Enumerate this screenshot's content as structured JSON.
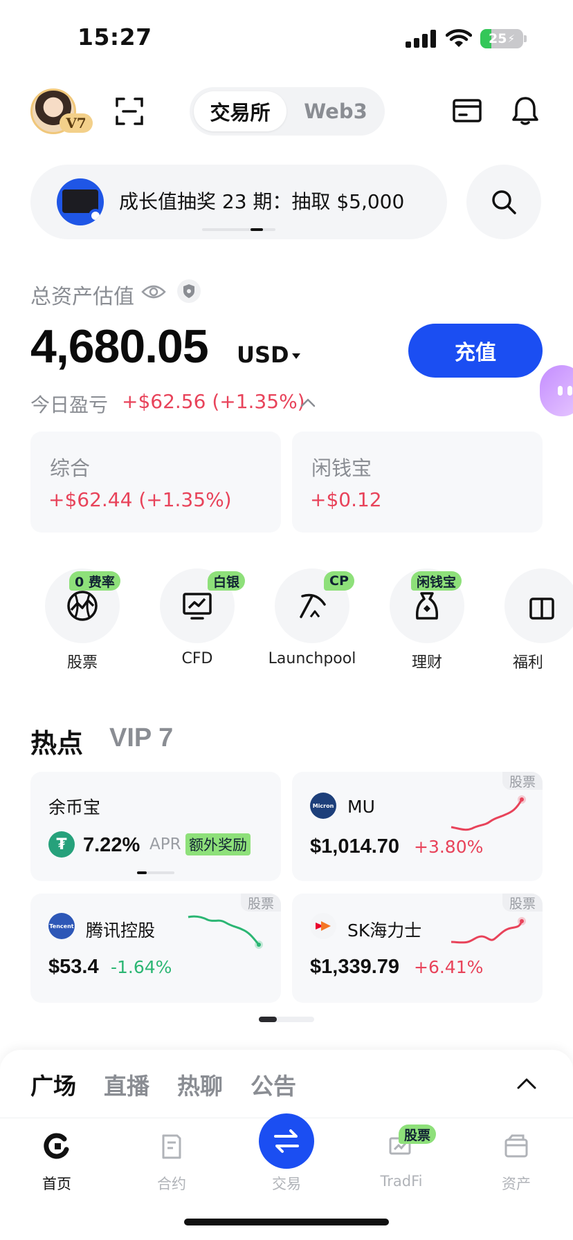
{
  "status_bar": {
    "time": "15:27",
    "battery": "25",
    "battery_level": 0.25
  },
  "header": {
    "vip_badge": "V7",
    "segments": [
      "交易所",
      "Web3"
    ],
    "active_segment": "交易所"
  },
  "promo": {
    "text": "成长值抽奖 23 期：抽取 $5,000"
  },
  "assets": {
    "label": "总资产估值",
    "amount": "4,680.05",
    "currency": "USD",
    "deposit_label": "充值",
    "pnl_label": "今日盈亏",
    "pnl_value": "+$62.56 (+1.35%)"
  },
  "pnl_cards": [
    {
      "title": "综合",
      "value": "+$62.44 (+1.35%)"
    },
    {
      "title": "闲钱宝",
      "value": "+$0.12"
    }
  ],
  "shortcuts": [
    {
      "label": "股票",
      "badge": "0 费率",
      "icon": "globe-chart-icon"
    },
    {
      "label": "CFD",
      "badge": "白银",
      "icon": "monitor-chart-icon"
    },
    {
      "label": "Launchpool",
      "badge": "CP",
      "icon": "pickaxe-icon"
    },
    {
      "label": "理财",
      "badge": "闲钱宝",
      "icon": "money-bag-icon"
    },
    {
      "label": "福利",
      "badge": "",
      "icon": "gift-icon"
    }
  ],
  "hot": {
    "title": "热点",
    "vip_tab": "VIP 7",
    "cards": [
      {
        "name": "余币宝",
        "apr_value": "7.22%",
        "apr_label": "APR",
        "extra": "额外奖励",
        "tag": ""
      },
      {
        "name": "MU",
        "price": "$1,014.70",
        "change": "+3.80%",
        "tag": "股票",
        "logo_text": "Micron"
      },
      {
        "name": "腾讯控股",
        "price": "$53.4",
        "change": "-1.64%",
        "tag": "股票",
        "logo_text": "Tencent"
      },
      {
        "name": "SK海力士",
        "price": "$1,339.79",
        "change": "+6.41%",
        "tag": "股票",
        "logo_text": ""
      }
    ]
  },
  "social_tabs": [
    "广场",
    "直播",
    "热聊",
    "公告"
  ],
  "nav": [
    {
      "label": "首页",
      "icon": "home-logo-icon",
      "active": true
    },
    {
      "label": "合约",
      "icon": "contract-icon",
      "active": false
    },
    {
      "label": "交易",
      "icon": "swap-icon",
      "active": false
    },
    {
      "label": "TradFi",
      "icon": "tradfi-icon",
      "active": false,
      "badge": "股票"
    },
    {
      "label": "资产",
      "icon": "wallet-icon",
      "active": false
    }
  ],
  "colors": {
    "accent": "#1b4ef2",
    "up": "#e8435a",
    "down": "#2bb673",
    "badge": "#8ee07a"
  }
}
